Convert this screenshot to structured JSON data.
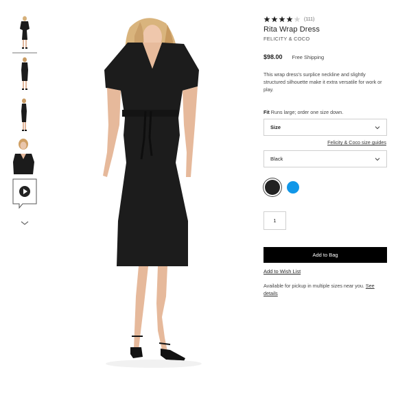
{
  "product": {
    "rating_count": "(111)",
    "rating_value": 4,
    "rating_max": 5,
    "title": "Rita Wrap Dress",
    "brand": "FELICITY & COCO",
    "price": "$98.00",
    "shipping": "Free Shipping",
    "description": "This wrap dress's surplice neckline and slightly structured silhouette make it extra versatile for work or play.",
    "fit_label": "Fit",
    "fit_note": "Runs large; order one size down."
  },
  "options": {
    "size_label": "Size",
    "size_guide": "Felicity & Coco size guides",
    "color_selected": "Black",
    "swatches": [
      {
        "name": "Black",
        "hex": "#222222"
      },
      {
        "name": "Blue",
        "hex": "#1197e8"
      }
    ],
    "quantity": "1"
  },
  "actions": {
    "add_to_bag": "Add to Bag",
    "wish_list": "Add to Wish List",
    "pickup_text": "Available for pickup in multiple sizes near you.",
    "pickup_link": "See details"
  },
  "gallery": {
    "thumbnail_count": 4,
    "has_video": true
  },
  "icons": [
    "star-icon",
    "chevron-down-icon",
    "play-icon"
  ]
}
